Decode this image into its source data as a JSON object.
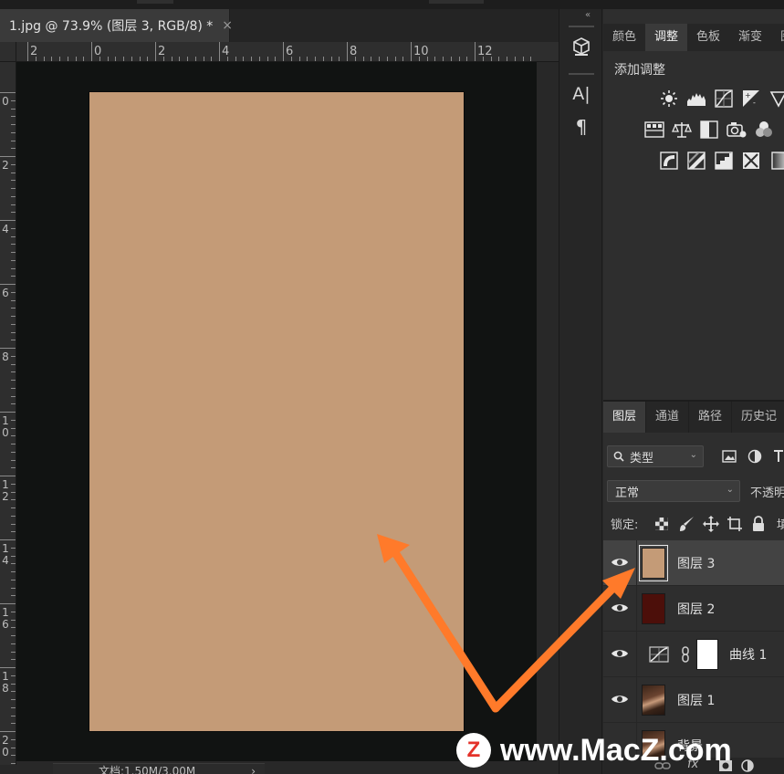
{
  "document": {
    "tab_title": "1.jpg @ 73.9% (图层 3, RGB/8) *",
    "close_glyph": "×",
    "canvas_color": "#c49b77",
    "pasteboard_color": "#111312"
  },
  "rulers": {
    "horizontal_labels": [
      "2",
      "0",
      "2",
      "4",
      "6",
      "8",
      "10",
      "12"
    ],
    "vertical_labels": [
      "0",
      "2",
      "4",
      "6",
      "8",
      "10",
      "12",
      "14",
      "16",
      "18",
      "20"
    ]
  },
  "status_bar": {
    "doc_info": "文档:1.50M/3.00M",
    "chevron": "›"
  },
  "tool_strip": {
    "collapse_glyph": "«",
    "tools": [
      {
        "name": "3d-cube-icon"
      },
      {
        "name": "character-icon",
        "glyph": "A|"
      },
      {
        "name": "paragraph-icon",
        "glyph": "¶"
      }
    ]
  },
  "adjustments_panel": {
    "tabs": [
      {
        "label": "颜色",
        "active": false
      },
      {
        "label": "调整",
        "active": true
      },
      {
        "label": "色板",
        "active": false
      },
      {
        "label": "渐变",
        "active": false
      },
      {
        "label": "图",
        "active": false
      }
    ],
    "title": "添加调整",
    "icons_row1": [
      "brightness-icon",
      "levels-icon",
      "curves-icon",
      "exposure-icon",
      "vibrance-icon"
    ],
    "icons_row2": [
      "hue-saturation-icon",
      "color-balance-icon",
      "black-white-icon",
      "photo-filter-icon",
      "channel-mixer-icon",
      "color-lookup-icon"
    ],
    "icons_row3": [
      "invert-icon",
      "posterize-icon",
      "threshold-icon",
      "selective-color-icon",
      "gradient-map-icon"
    ]
  },
  "layers_panel": {
    "tabs": [
      {
        "label": "图层",
        "active": true
      },
      {
        "label": "通道",
        "active": false
      },
      {
        "label": "路径",
        "active": false
      },
      {
        "label": "历史记",
        "active": false
      }
    ],
    "filter_kind": "类型",
    "blend_mode": "正常",
    "opacity_label": "不透明",
    "lock_label": "锁定:",
    "fill_label": "填",
    "layers": [
      {
        "name": "图层 3",
        "type": "fill",
        "color": "#c49b77",
        "selected": true
      },
      {
        "name": "图层 2",
        "type": "fill",
        "color": "#4c0f0a",
        "selected": false
      },
      {
        "name": "曲线 1",
        "type": "adjustment",
        "selected": false
      },
      {
        "name": "图层 1",
        "type": "photo",
        "selected": false
      },
      {
        "name": "背景",
        "type": "photo",
        "selected": false
      }
    ],
    "fx_label": "fx"
  },
  "watermark": {
    "logo_letter": "Z",
    "text": "www.MacZ.com",
    "logo_color": "#e4322a"
  },
  "annotation": {
    "arrow_color": "#ff7a2a"
  }
}
